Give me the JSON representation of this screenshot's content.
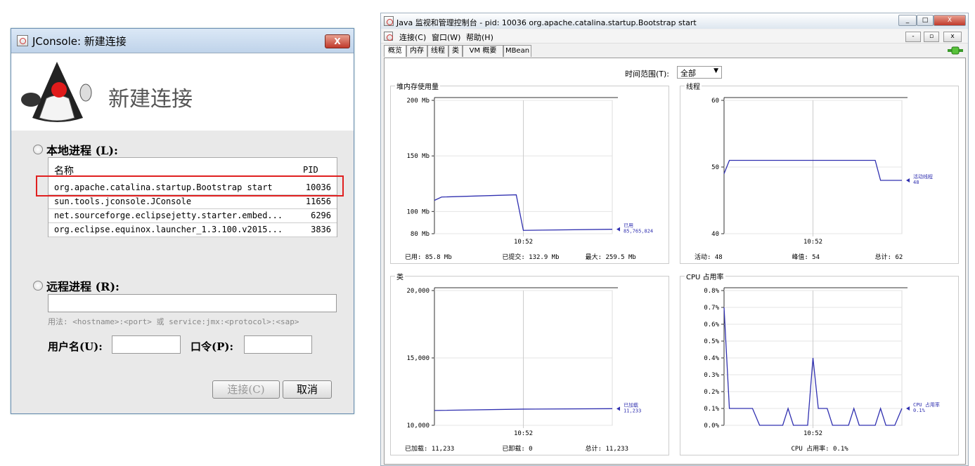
{
  "dialog": {
    "title": "JConsole: 新建连接",
    "close": "X",
    "banner_title": "新建连接",
    "local_label": "本地进程 (L):",
    "col_name": "名称",
    "col_pid": "PID",
    "processes": [
      {
        "name": "org.apache.catalina.startup.Bootstrap start",
        "pid": "10036"
      },
      {
        "name": "sun.tools.jconsole.JConsole",
        "pid": "11656"
      },
      {
        "name": "net.sourceforge.eclipsejetty.starter.embed...",
        "pid": "6296"
      },
      {
        "name": "org.eclipse.equinox.launcher_1.3.100.v2015...",
        "pid": "3836"
      }
    ],
    "remote_label": "远程进程 (R):",
    "usage": "用法: <hostname>:<port> 或 service:jmx:<protocol>:<sap>",
    "username_label": "用户名(U):",
    "password_label": "口令(P):",
    "connect_btn": "连接(C)",
    "cancel_btn": "取消"
  },
  "window": {
    "title": "Java 监视和管理控制台 - pid: 10036 org.apache.catalina.startup.Bootstrap start",
    "menu": [
      "连接(C)",
      "窗口(W)",
      "帮助(H)"
    ],
    "tabs": [
      "概览",
      "内存",
      "线程",
      "类",
      "VM 概要",
      "MBean"
    ],
    "time_range_label": "时间范围(T):",
    "time_range_value": "全部"
  },
  "chart_data": [
    {
      "type": "line",
      "title": "堆内存使用量",
      "y_ticks": [
        "200 Mb",
        "150 Mb",
        "100 Mb",
        "80 Mb"
      ],
      "ylim": [
        80,
        200
      ],
      "x_tick": "10:52",
      "series": [
        {
          "name": "已用",
          "values": [
            [
              0,
              110
            ],
            [
              0.04,
              113
            ],
            [
              0.46,
              115
            ],
            [
              0.5,
              83
            ],
            [
              1,
              84
            ]
          ]
        }
      ],
      "legend": [
        "已用",
        "85,765,824"
      ],
      "footer": [
        "已用: 85.8 Mb",
        "已提交: 132.9 Mb",
        "最大: 259.5 Mb"
      ]
    },
    {
      "type": "line",
      "title": "线程",
      "y_ticks": [
        "60",
        "50",
        "40"
      ],
      "ylim": [
        40,
        60
      ],
      "x_tick": "10:52",
      "series": [
        {
          "name": "活动线程",
          "values": [
            [
              0,
              49
            ],
            [
              0.03,
              51
            ],
            [
              0.85,
              51
            ],
            [
              0.88,
              48
            ],
            [
              1,
              48
            ]
          ]
        }
      ],
      "legend": [
        "活动线程",
        "48"
      ],
      "footer": [
        "活动: 48",
        "峰值: 54",
        "总计: 62"
      ]
    },
    {
      "type": "line",
      "title": "类",
      "y_ticks": [
        "20,000",
        "15,000",
        "10,000"
      ],
      "ylim": [
        10000,
        20000
      ],
      "x_tick": "10:52",
      "series": [
        {
          "name": "已加载",
          "values": [
            [
              0,
              11100
            ],
            [
              0.5,
              11200
            ],
            [
              1,
              11233
            ]
          ]
        }
      ],
      "legend": [
        "已加载",
        "11,233"
      ],
      "footer": [
        "已加载: 11,233",
        "已卸载: 0",
        "总计: 11,233"
      ]
    },
    {
      "type": "line",
      "title": "CPU 占用率",
      "y_ticks": [
        "0.8%",
        "0.7%",
        "0.6%",
        "0.5%",
        "0.4%",
        "0.3%",
        "0.2%",
        "0.1%",
        "0.0%"
      ],
      "ylim": [
        0,
        0.8
      ],
      "x_tick": "10:52",
      "series": [
        {
          "name": "CPU 占用率",
          "values": [
            [
              0,
              0.7
            ],
            [
              0.03,
              0.1
            ],
            [
              0.16,
              0.1
            ],
            [
              0.2,
              0
            ],
            [
              0.33,
              0
            ],
            [
              0.36,
              0.1
            ],
            [
              0.39,
              0
            ],
            [
              0.47,
              0
            ],
            [
              0.5,
              0.4
            ],
            [
              0.53,
              0.1
            ],
            [
              0.58,
              0.1
            ],
            [
              0.61,
              0
            ],
            [
              0.7,
              0
            ],
            [
              0.73,
              0.1
            ],
            [
              0.76,
              0
            ],
            [
              0.85,
              0
            ],
            [
              0.88,
              0.1
            ],
            [
              0.91,
              0
            ],
            [
              0.96,
              0
            ],
            [
              1,
              0.1
            ]
          ]
        }
      ],
      "legend": [
        "CPU 占用率",
        "0.1%"
      ],
      "footer": [
        "CPU 占用率: 0.1%"
      ]
    }
  ]
}
